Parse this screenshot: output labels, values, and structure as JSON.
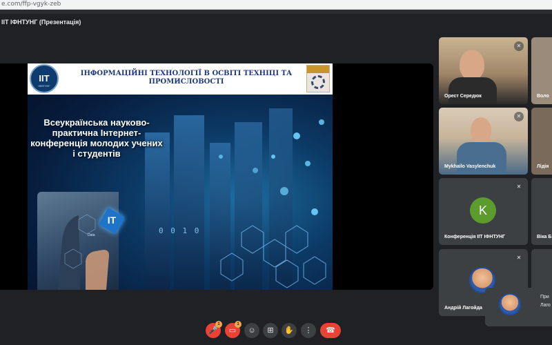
{
  "browser": {
    "url": "e.com/ffp-vgyk-zeb"
  },
  "meeting": {
    "title": "ІІТ ІФНТУНГ (Презентація)"
  },
  "slide": {
    "logo_left_text": "ІІТ",
    "logo_left_caption": "ІФНТУНГ",
    "title": "ІНФОРМАЦІЙНІ ТЕХНОЛОГІЇ В ОСВІТІ ТЕХНІЦІ ТА ПРОМИСЛОВОСТІ",
    "subtitle": "Всеукраїнська науково-практична Інтернет-конференція молодих учених і студентів",
    "it_badge": "IT",
    "data_label": "Data",
    "binary": "0 0 1 0"
  },
  "participants": [
    {
      "name": "Орест Середюк",
      "mic": "muted"
    },
    {
      "name": "Воло",
      "mic": "muted"
    },
    {
      "name": "Mykhailo Vasylenchuk",
      "mic": "muted"
    },
    {
      "name": "Лідія",
      "mic": ""
    },
    {
      "name": "Конференція ІІТ ІФНТУНГ",
      "mic": "muted",
      "avatar_letter": "K"
    },
    {
      "name": "Віка Б",
      "mic": ""
    },
    {
      "name": "Андрій Лагойда",
      "mic": "muted"
    }
  ],
  "self_view": {
    "line1": "При",
    "line2": "Лаго"
  },
  "controls": {
    "mic_badge": "1",
    "camera_badge": "1",
    "icons": [
      "microphone-off-icon",
      "camera-off-icon",
      "captions-icon",
      "present-icon",
      "raise-hand-icon",
      "more-options-icon",
      "end-call-icon"
    ]
  },
  "colors": {
    "background": "#202124",
    "tile": "#3c4043",
    "danger": "#ea4335",
    "avatar_k": "#5c9c2d"
  }
}
